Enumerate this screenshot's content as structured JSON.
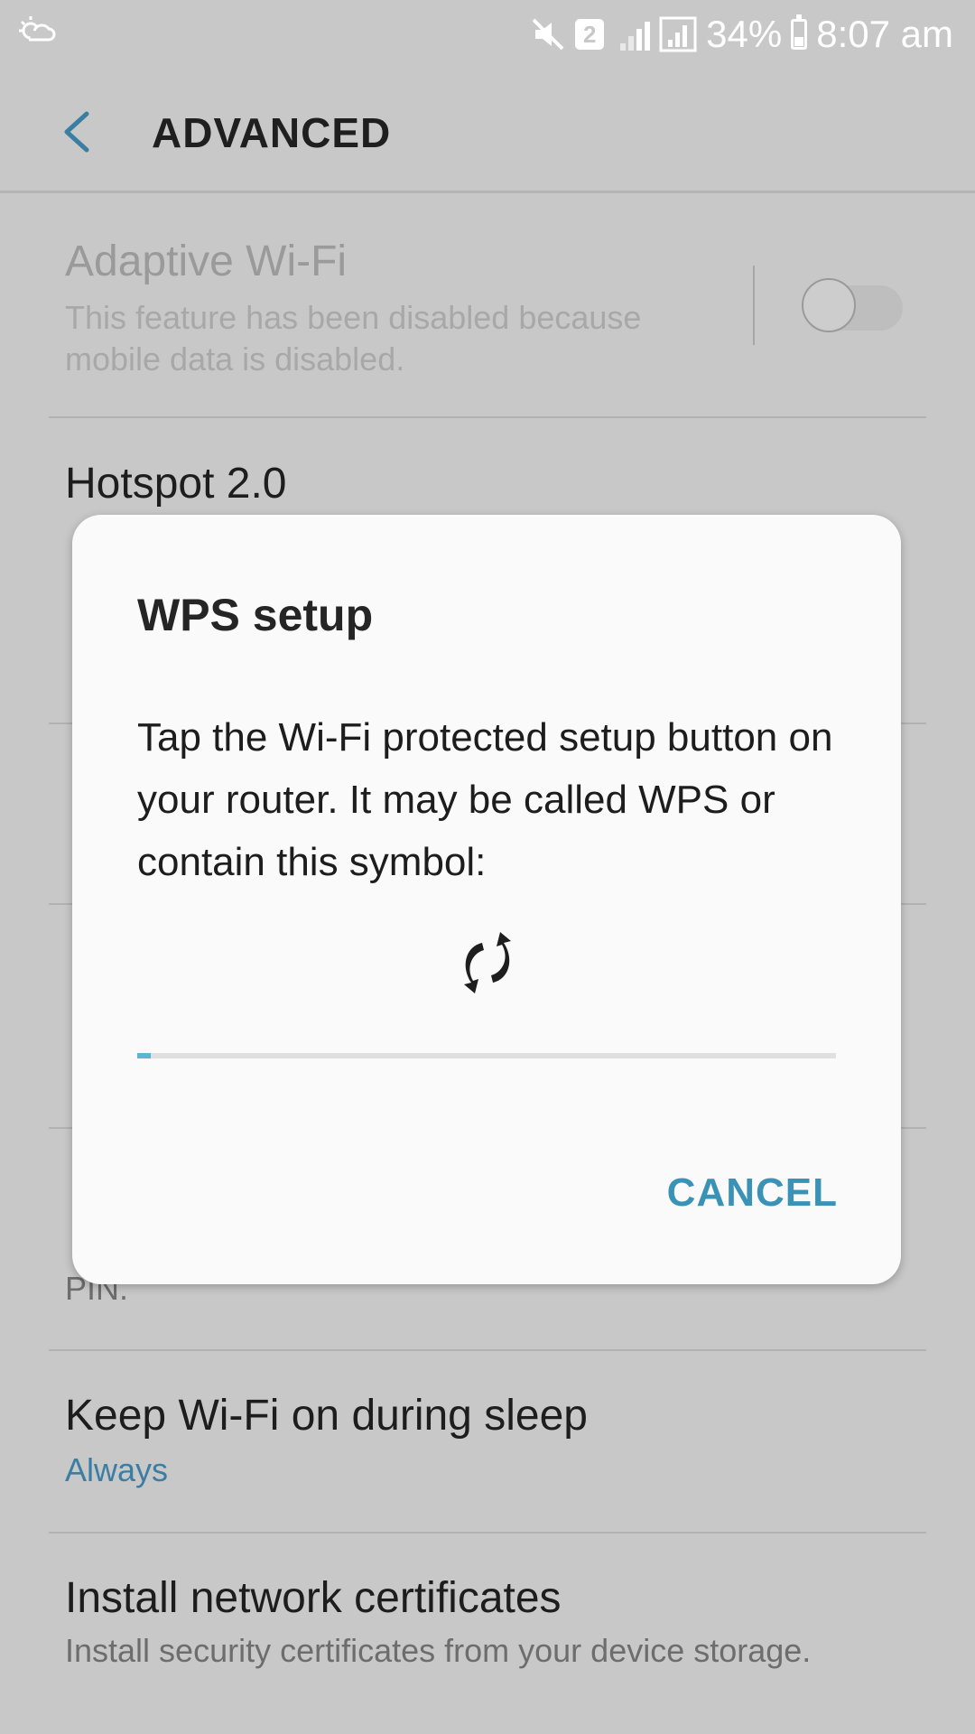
{
  "status_bar": {
    "sim_slot": "2",
    "battery": "34%",
    "battery_level": 0.34,
    "time": "8:07 am",
    "icons": [
      "weather-icon",
      "mute-icon",
      "sim-icon",
      "signal-icon",
      "battery-icon"
    ]
  },
  "app_bar": {
    "title": "ADVANCED",
    "back_icon": "back-arrow-icon"
  },
  "settings": [
    {
      "title": "Adaptive Wi-Fi",
      "subtitle": "This feature has been disabled because mobile data is disabled.",
      "disabled": true,
      "toggle": false
    },
    {
      "title": "Hotspot 2.0"
    },
    {
      "title": "Keep Wi-Fi on during sleep",
      "value": "Always"
    },
    {
      "title": "Install network certificates",
      "subtitle": "Install security certificates from your device storage."
    }
  ],
  "partial_texts": {
    "row5_tail": "PIN."
  },
  "dialog": {
    "title": "WPS setup",
    "body": "Tap the Wi-Fi protected setup button on your router. It may be called WPS or contain this symbol:",
    "icon": "wps-icon",
    "progress": 0.02,
    "cancel_label": "CANCEL"
  },
  "colors": {
    "accent": "#3a7ea3",
    "button": "#3a93b7",
    "progress": "#5ab6d6",
    "scrim_background": "#c8c8c8"
  }
}
